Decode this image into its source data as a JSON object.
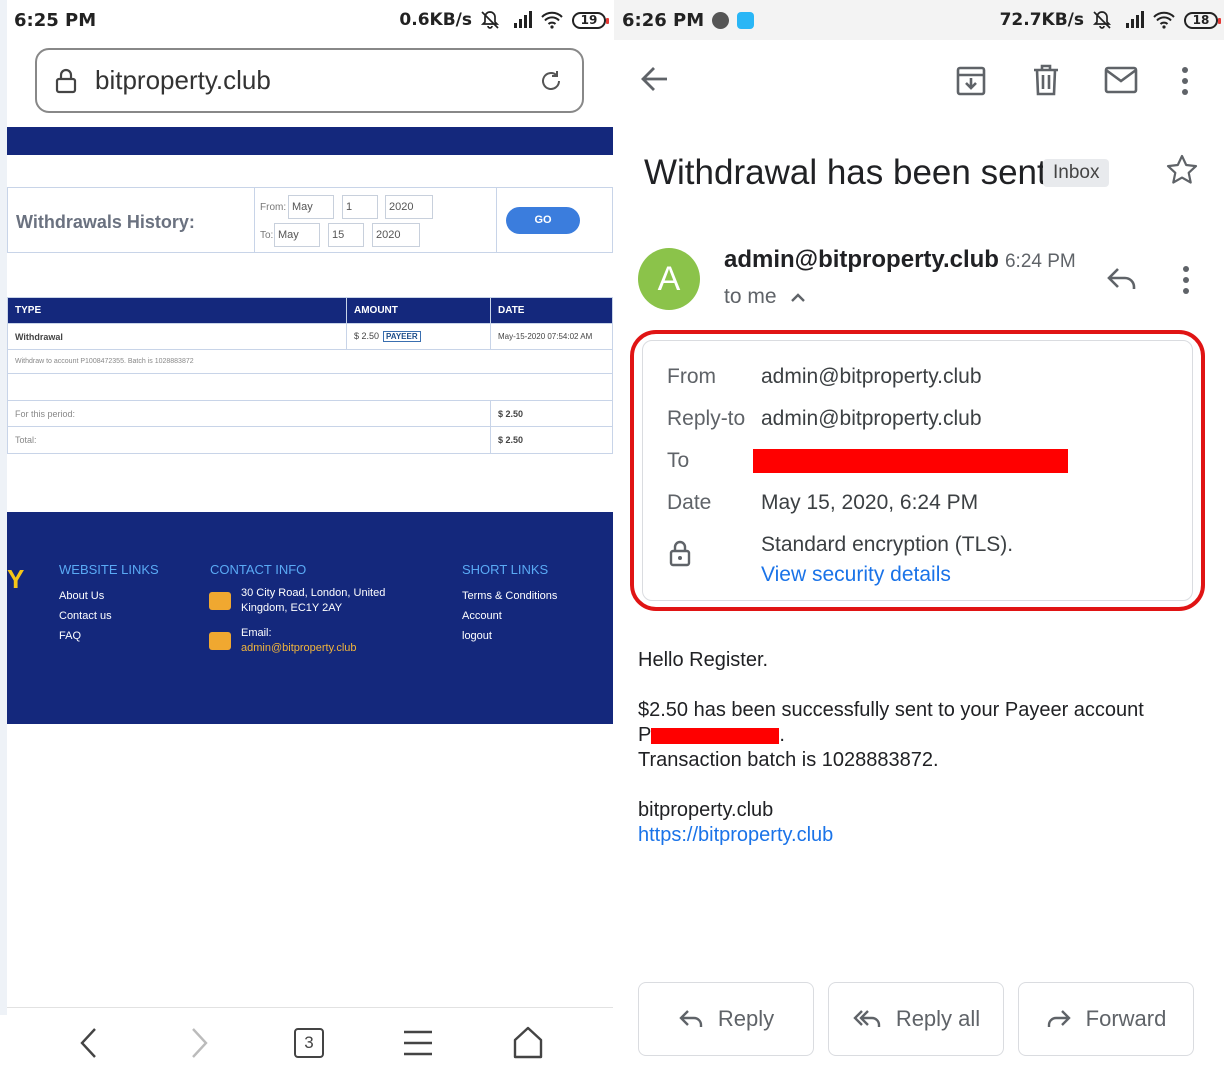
{
  "left_phone": {
    "status": {
      "time": "6:25 PM",
      "speed": "0.6KB/s",
      "network": "4G",
      "battery": "19"
    },
    "url_bar": {
      "url": "bitproperty.club"
    },
    "history_form": {
      "title": "Withdrawals History:",
      "from_label": "From:",
      "to_label": "To:",
      "from": {
        "month": "May",
        "day": "1",
        "year": "2020"
      },
      "to": {
        "month": "May",
        "day": "15",
        "year": "2020"
      },
      "go_label": "GO"
    },
    "table": {
      "headers": [
        "TYPE",
        "AMOUNT",
        "DATE"
      ],
      "row": {
        "type": "Withdrawal",
        "amount": "$ 2.50",
        "payment_badge": "PAYEER",
        "date": "May-15-2020 07:54:02 AM"
      },
      "note": "Withdraw to account P1008472355. Batch is 1028883872",
      "period_label": "For this period:",
      "period_value": "$ 2.50",
      "total_label": "Total:",
      "total_value": "$ 2.50"
    },
    "footer": {
      "logo_fragment": "Y",
      "website_links_title": "WEBSITE LINKS",
      "website_links": [
        "About Us",
        "Contact us",
        "FAQ"
      ],
      "contact_title": "CONTACT INFO",
      "address_line1": "30 City Road, London, United",
      "address_line2": "Kingdom, EC1Y 2AY",
      "email_label": "Email:",
      "email": "admin@bitproperty.club",
      "short_links_title": "SHORT LINKS",
      "short_links": [
        "Terms & Conditions",
        "Account",
        "logout"
      ]
    },
    "nav": {
      "tab_count": "3"
    }
  },
  "right_phone": {
    "status": {
      "time": "6:26 PM",
      "speed": "72.7KB/s",
      "network": "4G",
      "battery": "18"
    },
    "email": {
      "subject": "Withdrawal has been sent",
      "label": "Inbox",
      "avatar_letter": "A",
      "sender": "admin@bitproperty.club",
      "time": "6:24 PM",
      "to_me": "to me",
      "details": {
        "from_label": "From",
        "from": "admin@bitproperty.club",
        "reply_to_label": "Reply-to",
        "reply_to": "admin@bitproperty.club",
        "to_label": "To",
        "date_label": "Date",
        "date": "May 15, 2020, 6:24 PM",
        "encryption": "Standard encryption (TLS).",
        "security_link": "View security details"
      },
      "body": {
        "greeting": "Hello Register.",
        "line1": "$2.50 has been successfully sent to your Payeer account",
        "line2_prefix": "P",
        "line2_suffix": ".",
        "line3": "Transaction batch is 1028883872.",
        "signature": "bitproperty.club",
        "link": "https://bitproperty.club"
      },
      "actions": {
        "reply": "Reply",
        "reply_all": "Reply all",
        "forward": "Forward"
      }
    }
  },
  "colors": {
    "site_navy": "#14287c",
    "go_blue": "#3b7ddd",
    "gmail_link": "#1a73e8",
    "redaction": "#ff0000",
    "avatar_green": "#8bc34a"
  }
}
